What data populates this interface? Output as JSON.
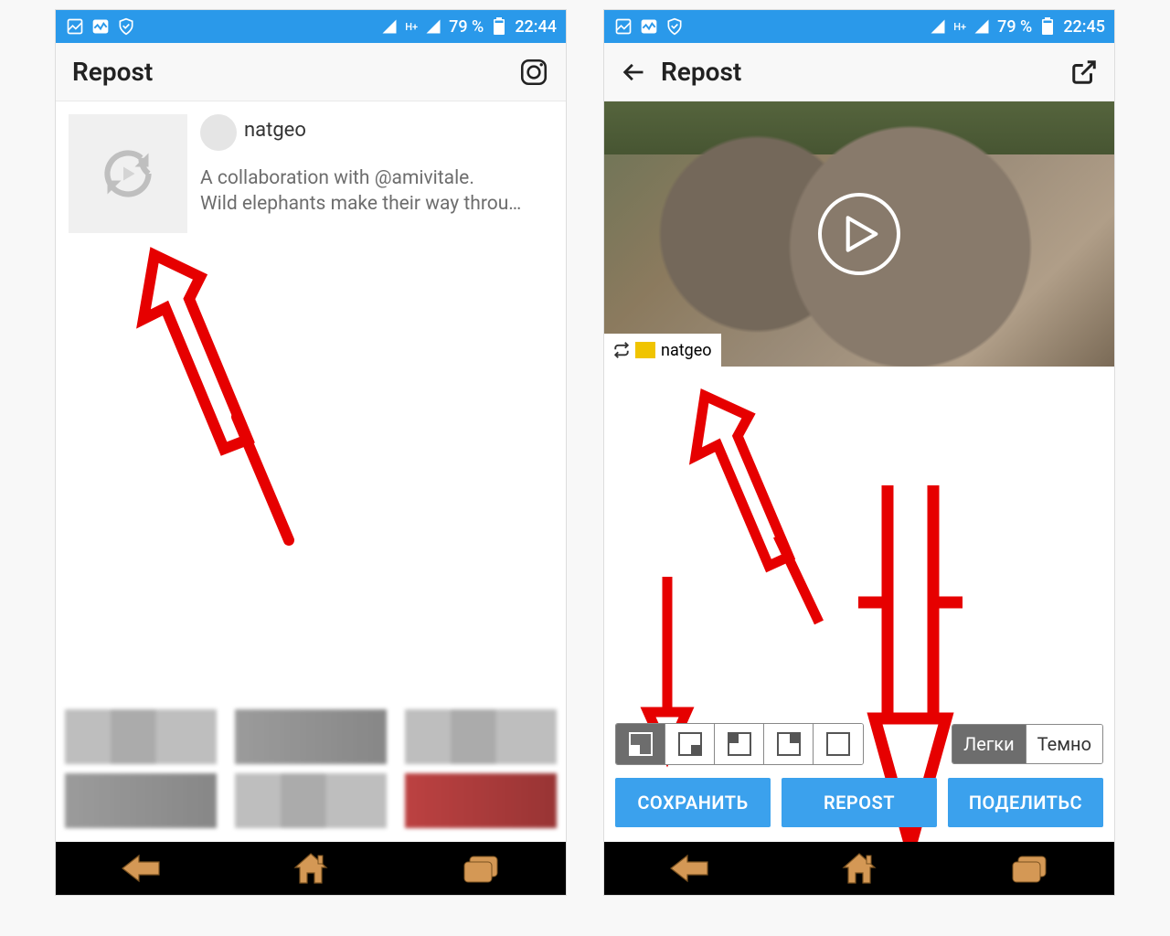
{
  "statusbar_left": {
    "battery": "79 %"
  },
  "left": {
    "title": "Repost",
    "time": "22:44",
    "row": {
      "username": "natgeo",
      "caption_line1": "A collaboration with @amivitale.",
      "caption_line2": "Wild elephants make their way throu…"
    }
  },
  "right": {
    "title": "Repost",
    "time": "22:45",
    "watermark_user": "natgeo",
    "theme_light": "Легки",
    "theme_dark": "Темно",
    "btn_save": "СОХРАНИТЬ",
    "btn_repost": "REPOST",
    "btn_share": "ПОДЕЛИТЬС"
  }
}
